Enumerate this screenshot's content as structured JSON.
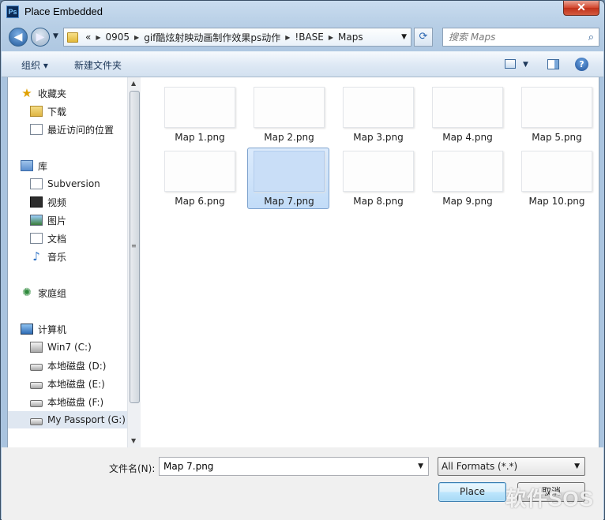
{
  "window": {
    "app_icon": "Ps",
    "title": "Place Embedded",
    "close_label": "✕"
  },
  "address_bar": {
    "overflow": "«",
    "crumbs": [
      "0905",
      "gif酷炫射映动画制作效果ps动作",
      "!BASE",
      "Maps"
    ]
  },
  "search": {
    "placeholder": "搜索 Maps"
  },
  "toolbar": {
    "organize": "组织 ▾",
    "new_folder": "新建文件夹",
    "help": "?"
  },
  "nav": {
    "items": [
      {
        "label": "收藏夹",
        "icon": "star-icon"
      },
      {
        "label": "下载",
        "icon": "download-folder-icon"
      },
      {
        "label": "最近访问的位置",
        "icon": "recent-places-icon"
      },
      {
        "label": "库",
        "icon": "library-icon"
      },
      {
        "label": "Subversion",
        "icon": "document-icon"
      },
      {
        "label": "视频",
        "icon": "video-icon"
      },
      {
        "label": "图片",
        "icon": "picture-icon"
      },
      {
        "label": "文档",
        "icon": "document-icon"
      },
      {
        "label": "音乐",
        "icon": "music-icon"
      },
      {
        "label": "家庭组",
        "icon": "homegroup-icon"
      },
      {
        "label": "计算机",
        "icon": "computer-icon"
      },
      {
        "label": "Win7 (C:)",
        "icon": "system-drive-icon"
      },
      {
        "label": "本地磁盘 (D:)",
        "icon": "drive-icon"
      },
      {
        "label": "本地磁盘 (E:)",
        "icon": "drive-icon"
      },
      {
        "label": "本地磁盘 (F:)",
        "icon": "drive-icon"
      },
      {
        "label": "My Passport (G:)",
        "icon": "drive-icon"
      }
    ],
    "selected_index": 15
  },
  "files": [
    "Map 1.png",
    "Map 2.png",
    "Map 3.png",
    "Map 4.png",
    "Map 5.png",
    "Map 6.png",
    "Map 7.png",
    "Map 8.png",
    "Map 9.png",
    "Map 10.png"
  ],
  "selected_file": "Map 7.png",
  "footer": {
    "filename_label": "文件名(N):",
    "filename_value": "Map 7.png",
    "format_value": "All Formats (*.*)",
    "place_label": "Place",
    "cancel_label": "取消"
  },
  "watermark": "软件SOS"
}
